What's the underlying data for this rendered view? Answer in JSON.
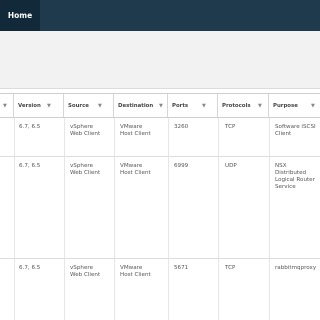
{
  "topbar": {
    "home_label": "Home"
  },
  "table": {
    "headers": [
      "Version",
      "Source",
      "Destination",
      "Ports",
      "Protocols",
      "Purpose"
    ],
    "rows": [
      [
        "6.7, 6.5",
        "vSphere\nWeb Client",
        "VMware\nHost Client",
        "3260",
        "TCP",
        "Software iSCSI\nClient"
      ],
      [
        "6.7, 6.5",
        "vSphere\nWeb Client",
        "VMware\nHost Client",
        "6999",
        "UDP",
        "NSX\nDistributed\nLogical Router\nService"
      ],
      [
        "6.7, 6.5",
        "vSphere\nWeb Client",
        "VMware\nHost Client",
        "5671",
        "TCP",
        "rabbitmqproxy"
      ]
    ]
  },
  "icons": {
    "filter": "filter-icon"
  }
}
